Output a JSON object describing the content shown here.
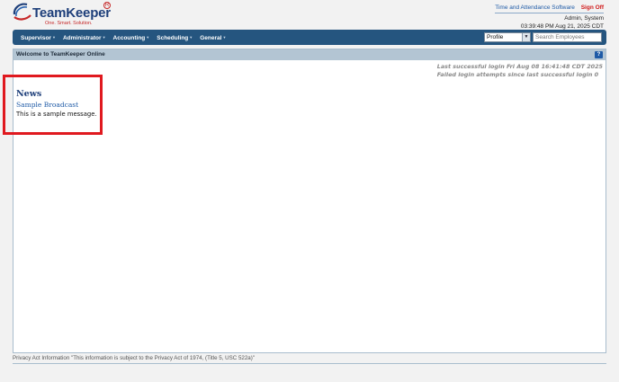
{
  "brand": {
    "name": "TeamKeeper",
    "tagline": "One. Smart. Solution.",
    "registered_mark": "R"
  },
  "header": {
    "app_link": "Time and Attendance Software",
    "signoff_link": "Sign Off",
    "user": "Admin, System",
    "datetime": "03:39:48 PM Aug 21, 2025 CDT"
  },
  "nav": {
    "items": [
      "Supervisor",
      "Administrator",
      "Accounting",
      "Scheduling",
      "General"
    ],
    "profile_select": "Profile",
    "search_placeholder": "Search Employees"
  },
  "panel": {
    "title": "Welcome to TeamKeeper Online",
    "help": "?",
    "last_login": "Last successful login Fri Aug 08 16:41:48 CDT 2025",
    "failed_attempts": "Failed login attempts since last successful login 0"
  },
  "news": {
    "heading": "News",
    "items": [
      {
        "title": "Sample Broadcast",
        "body": "This is a sample message."
      }
    ]
  },
  "footer": {
    "privacy": "Privacy Act Information \"This information is subject to the Privacy Act of 1974, (Title 5, USC 522a)\""
  },
  "colors": {
    "nav_bg": "#25557f",
    "panel_title_bg": "#b3c5d3",
    "brand_blue": "#1e3f7a",
    "brand_red": "#c62828",
    "highlight_red": "#e0191f"
  }
}
